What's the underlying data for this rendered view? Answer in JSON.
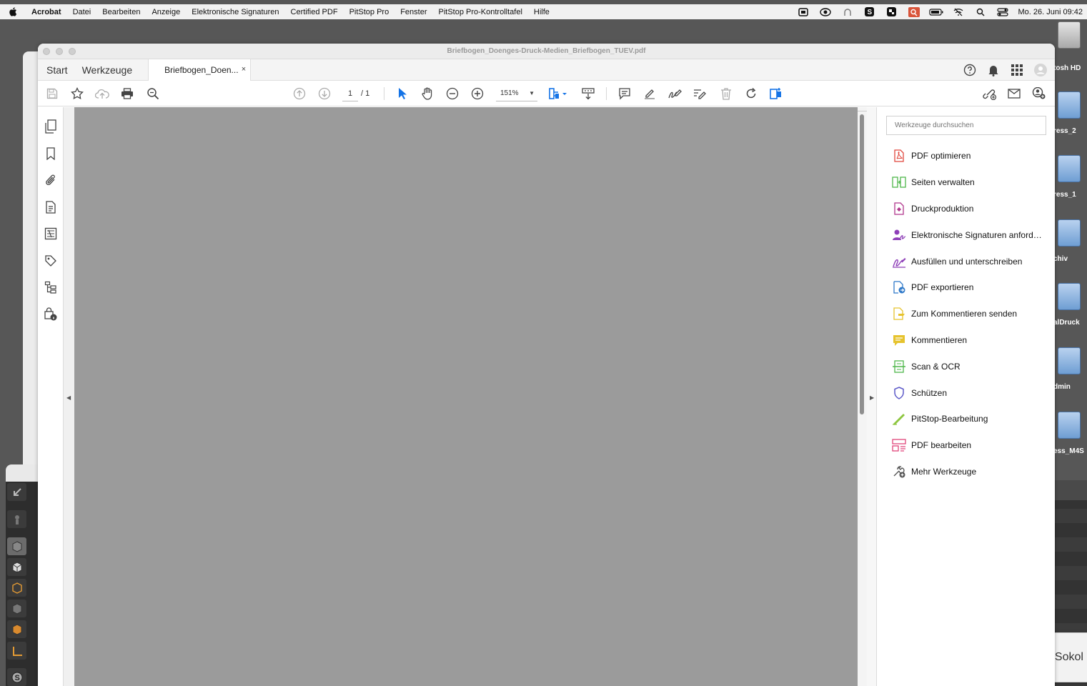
{
  "menubar": {
    "app": "Acrobat",
    "items": [
      "Datei",
      "Bearbeiten",
      "Anzeige",
      "Elektronische Signaturen",
      "Certified PDF",
      "PitStop Pro",
      "Fenster",
      "PitStop Pro-Kontrolltafel",
      "Hilfe"
    ],
    "clock": "Mo. 26. Juni  09:42"
  },
  "window": {
    "title": "Briefbogen_Doenges-Druck-Medien_Briefbogen_TUEV.pdf"
  },
  "tabs": {
    "start": "Start",
    "tools": "Werkzeuge",
    "document": "Briefbogen_Doen...",
    "close": "×"
  },
  "toolbar": {
    "page_current": "1",
    "page_total": "/ 1",
    "zoom": "151%"
  },
  "tools_panel": {
    "search_placeholder": "Werkzeuge durchsuchen",
    "items": [
      {
        "label": "PDF optimieren",
        "icon": "pdf-optimize-icon",
        "color": "#e0463c"
      },
      {
        "label": "Seiten verwalten",
        "icon": "organize-pages-icon",
        "color": "#4fb74a"
      },
      {
        "label": "Druckproduktion",
        "icon": "print-production-icon",
        "color": "#b1358c"
      },
      {
        "label": "Elektronische Signaturen anford…",
        "icon": "request-signatures-icon",
        "color": "#8e3fb8"
      },
      {
        "label": "Ausfüllen und unterschreiben",
        "icon": "fill-sign-icon",
        "color": "#8e3fb8"
      },
      {
        "label": "PDF exportieren",
        "icon": "export-pdf-icon",
        "color": "#2f79c9"
      },
      {
        "label": "Zum Kommentieren senden",
        "icon": "send-comments-icon",
        "color": "#e6c32e"
      },
      {
        "label": "Kommentieren",
        "icon": "comment-icon",
        "color": "#e6c32e"
      },
      {
        "label": "Scan & OCR",
        "icon": "scan-ocr-icon",
        "color": "#4fb74a"
      },
      {
        "label": "Schützen",
        "icon": "protect-shield-icon",
        "color": "#5b58c8"
      },
      {
        "label": "PitStop-Bearbeitung",
        "icon": "pitstop-edit-icon",
        "color": "#8dc63f"
      },
      {
        "label": "PDF bearbeiten",
        "icon": "edit-pdf-icon",
        "color": "#e0457a"
      },
      {
        "label": "Mehr Werkzeuge",
        "icon": "more-tools-icon",
        "color": "#555555"
      }
    ]
  },
  "desktop": {
    "labels": [
      "tosh HD",
      "ress_2",
      "ress_1",
      "chiv",
      "alDruck",
      "dmin",
      "ess_M4S"
    ],
    "notification": "Jeremy Sokol"
  }
}
